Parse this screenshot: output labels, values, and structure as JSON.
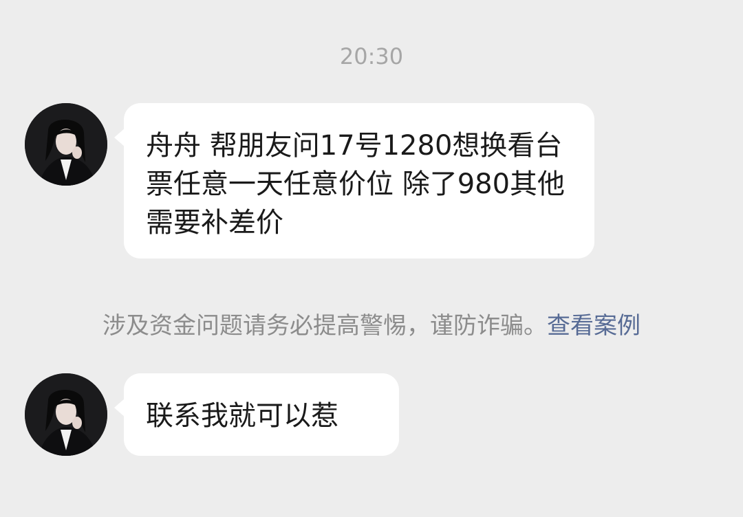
{
  "chat": {
    "timestamp": "20:30",
    "messages": [
      {
        "sender": "friend",
        "text": "舟舟 帮朋友问17号1280想换看台票任意一天任意价位 除了980其他需要补差价"
      },
      {
        "sender": "friend",
        "text": "联系我就可以惹"
      }
    ],
    "system_notice": {
      "text": "涉及资金问题请务必提高警惕，谨防诈骗。",
      "link": "查看案例"
    }
  },
  "colors": {
    "background": "#ededed",
    "bubble": "#ffffff",
    "link": "#576b95",
    "muted": "#8c8c8c"
  },
  "icons": {
    "avatar": "contact-avatar"
  }
}
